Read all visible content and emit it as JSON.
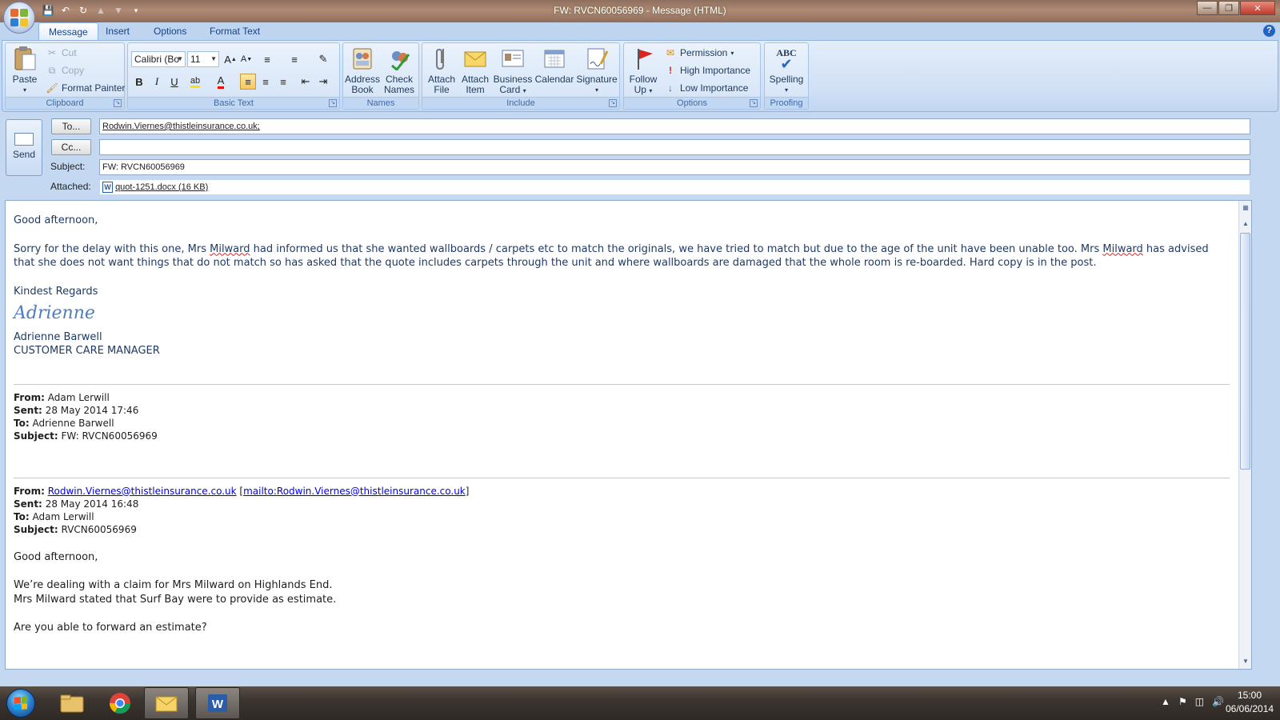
{
  "window": {
    "title": "FW: RVCN60056969 - Message (HTML)"
  },
  "tabs": [
    "Message",
    "Insert",
    "Options",
    "Format Text"
  ],
  "ribbon": {
    "clipboard": {
      "label": "Clipboard",
      "paste": "Paste",
      "cut": "Cut",
      "copy": "Copy",
      "format_painter": "Format Painter"
    },
    "basic_text": {
      "label": "Basic Text",
      "font": "Calibri (Bo",
      "size": "11"
    },
    "names": {
      "label": "Names",
      "address_book_1": "Address",
      "address_book_2": "Book",
      "check_names_1": "Check",
      "check_names_2": "Names"
    },
    "include": {
      "label": "Include",
      "attach_file_1": "Attach",
      "attach_file_2": "File",
      "attach_item_1": "Attach",
      "attach_item_2": "Item",
      "business_card_1": "Business",
      "business_card_2": "Card",
      "calendar": "Calendar",
      "signature": "Signature"
    },
    "options": {
      "label": "Options",
      "follow_up_1": "Follow",
      "follow_up_2": "Up",
      "permission": "Permission",
      "high_importance": "High Importance",
      "low_importance": "Low Importance"
    },
    "proofing": {
      "label": "Proofing",
      "spelling": "Spelling",
      "abc": "ABC"
    }
  },
  "header": {
    "send": "Send",
    "to_button": "To...",
    "cc_button": "Cc...",
    "subject_label": "Subject:",
    "attached_label": "Attached:",
    "to_value": "Rodwin.Viernes@thistleinsurance.co.uk;",
    "cc_value": "",
    "subject_value": "FW: RVCN60056969",
    "attachment": "quot-1251.docx (16 KB)"
  },
  "message": {
    "greeting": "Good  afternoon,",
    "para1_a": "Sorry for the delay with this one, Mrs ",
    "para1_name1": "Milward",
    "para1_b": " had informed us that she wanted wallboards / carpets etc to match the originals, we have tried to match but due to the age of the unit have been unable too.  Mrs ",
    "para1_name2": "Milward",
    "para1_c": " has advised that she does not want things that do not match so has asked that the quote includes carpets through the unit and where wallboards are damaged that the whole room is re-boarded.  Hard copy is in the post.",
    "regards": "Kindest Regards",
    "signature_script": "Adrienne",
    "sig_name": "Adrienne Barwell",
    "sig_title": "CUSTOMER CARE MANAGER",
    "fwd1": {
      "from_label": "From:",
      "from": "Adam Lerwill",
      "sent_label": "Sent:",
      "sent": "28 May 2014 17:46",
      "to_label": "To:",
      "to": "Adrienne Barwell",
      "subject_label": "Subject:",
      "subject": "FW: RVCN60056969"
    },
    "fwd2": {
      "from_label": "From:",
      "from_link": "Rodwin.Viernes@thistleinsurance.co.uk",
      "mailto": "mailto:Rodwin.Viernes@thistleinsurance.co.uk",
      "sent_label": "Sent:",
      "sent": "28 May 2014 16:48",
      "to_label": "To:",
      "to": "Adam Lerwill",
      "subject_label": "Subject:",
      "subject": "RVCN60056969"
    },
    "orig_greeting": "Good afternoon,",
    "orig_line1": "We’re dealing with a claim for Mrs Milward on Highlands End.",
    "orig_line2": "Mrs Milward stated that Surf Bay were to provide as estimate.",
    "orig_line3": "Are you able to forward an estimate?"
  },
  "taskbar": {
    "time": "15:00",
    "date": "06/06/2014"
  },
  "colors": {
    "ribbon_accent": "#15428b",
    "link": "#0000ee",
    "body_text": "#1f3b64"
  }
}
